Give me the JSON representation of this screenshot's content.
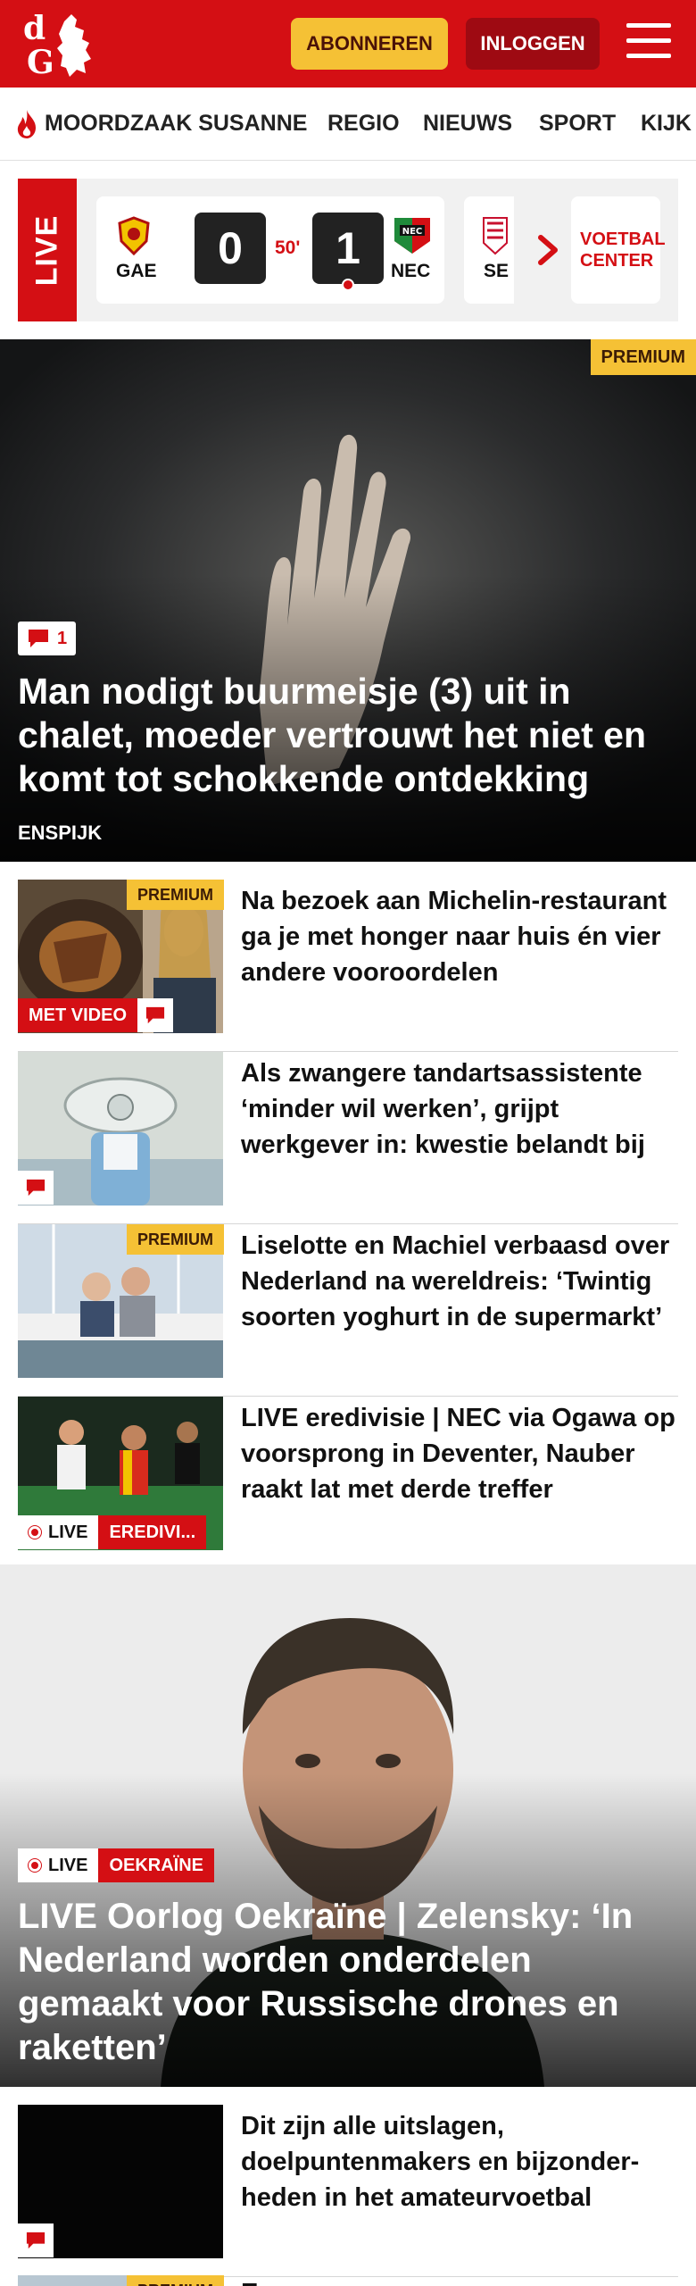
{
  "header": {
    "logo_alt": "dG",
    "subscribe_label": "ABONNEREN",
    "login_label": "INLOGGEN",
    "brand_color": "#d40f14"
  },
  "nav": {
    "items": [
      {
        "label": "MOORDZAAK SUSANNE",
        "icon": "flame-icon"
      },
      {
        "label": "REGIO"
      },
      {
        "label": "NIEUWS"
      },
      {
        "label": "SPORT"
      },
      {
        "label": "KIJK"
      }
    ]
  },
  "livebar": {
    "live_label": "LIVE",
    "match": {
      "home_team": "GAE",
      "away_team": "NEC",
      "home_score": "0",
      "away_score": "1",
      "minute": "50'"
    },
    "next_match_team": "SE",
    "center_label": "VOETBAL CENTER"
  },
  "hero": {
    "badge": "PREMIUM",
    "comments": "1",
    "title": "Man nodigt buurmeisje (3) uit in chalet, moeder vertrouwt het niet en komt tot schokkende ontdekking",
    "location": "ENSPIJK"
  },
  "articles": [
    {
      "badge": "PREMIUM",
      "tag": "MET VIDEO",
      "title": "Na bezoek aan Michelin-restaurant ga je met honger naar huis én vier andere vooroordelen"
    },
    {
      "title": "Als zwangere tandartsassistente ‘minder wil werken’, grijpt werkgever in: kwestie belandt bij de rechter"
    },
    {
      "badge": "PREMIUM",
      "title": "Liselotte en Machiel verbaasd over Nederland na wereldreis: ‘Twintig soorten yoghurt in de supermarkt’"
    },
    {
      "live_label": "LIVE",
      "tag": "EREDIVI...",
      "title": "LIVE eredivisie | NEC via Ogawa op voorsprong in Deventer, Nauber raakt lat met derde treffer"
    }
  ],
  "hero2": {
    "live_label": "LIVE",
    "tag": "OEKRAÏNE",
    "title": "LIVE Oorlog Oekraïne | Zelensky: ‘In Nederland worden onderdelen gemaakt voor Russische drones en raketten’"
  },
  "bottom_article": {
    "title": "Dit zijn alle uitslagen, doelpuntenmakers en bijzonder-heden in het amateurvoetbal"
  },
  "peek": {
    "badge": "PREMIUM",
    "title": "Er"
  }
}
